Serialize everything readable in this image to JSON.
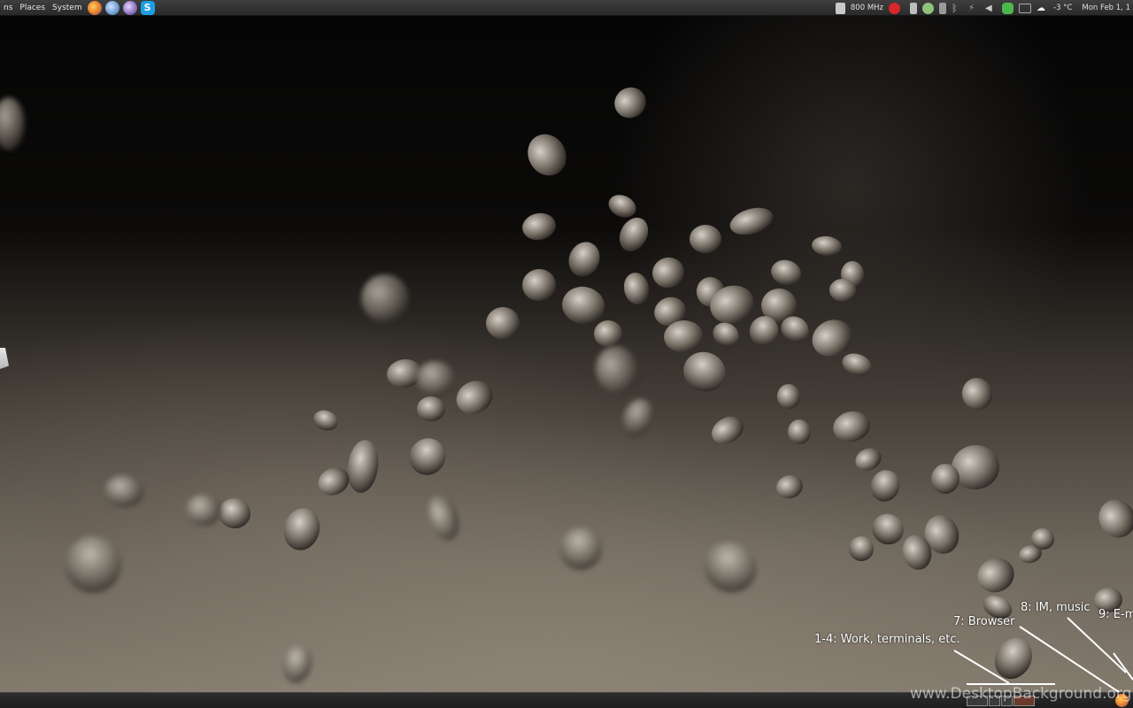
{
  "top_panel": {
    "menus": [
      "ns",
      "Places",
      "System"
    ],
    "launchers": [
      {
        "name": "firefox-icon",
        "color": "#e8782a"
      },
      {
        "name": "mail-client-icon",
        "color": "#5b8fc9"
      },
      {
        "name": "im-client-icon",
        "color": "#7a5fb0"
      },
      {
        "name": "skype-icon",
        "color": "#1c9ee0"
      }
    ],
    "tray": {
      "cpu_freq": "800 MHz",
      "temperature": "-3 °C",
      "clock": "Mon Feb  1, 1"
    }
  },
  "annotations": {
    "work": "1-4: Work, terminals, etc.",
    "browser": "7: Browser",
    "im": "8: IM, music",
    "email": "9: E-m"
  },
  "watermark": "www.DesktopBackground.org",
  "colors": {
    "panel": "#2f2f2f",
    "annotation": "#ffffff"
  }
}
